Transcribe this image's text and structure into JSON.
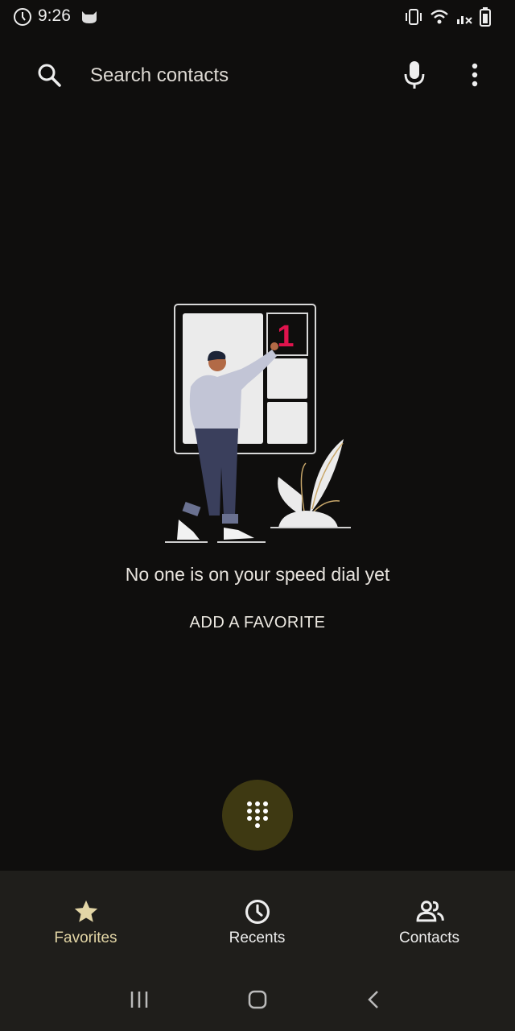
{
  "status_bar": {
    "time": "9:26",
    "icons": [
      "timer-icon",
      "cat-icon",
      "vibrate-icon",
      "wifi-icon",
      "signal-icon",
      "battery-icon"
    ]
  },
  "search": {
    "placeholder": "Search contacts",
    "icons": [
      "search-icon",
      "mic-icon",
      "more-vert-icon"
    ]
  },
  "empty_state": {
    "illustration_number": "1",
    "message": "No one is on your speed dial yet",
    "action_label": "ADD A FAVORITE"
  },
  "fab": {
    "icon": "dialpad-icon"
  },
  "bottom_nav": {
    "items": [
      {
        "label": "Favorites",
        "icon": "star-icon",
        "selected": true
      },
      {
        "label": "Recents",
        "icon": "clock-icon",
        "selected": false
      },
      {
        "label": "Contacts",
        "icon": "people-icon",
        "selected": false
      }
    ]
  },
  "system_nav": {
    "buttons": [
      "recent-apps-icon",
      "home-icon",
      "back-icon"
    ]
  },
  "colors": {
    "background": "#0f0e0d",
    "selected_accent": "#e3d6a6",
    "fab_background": "#3e3912",
    "nav_background": "#1f1e1b",
    "illustration_number": "#e0134d"
  }
}
